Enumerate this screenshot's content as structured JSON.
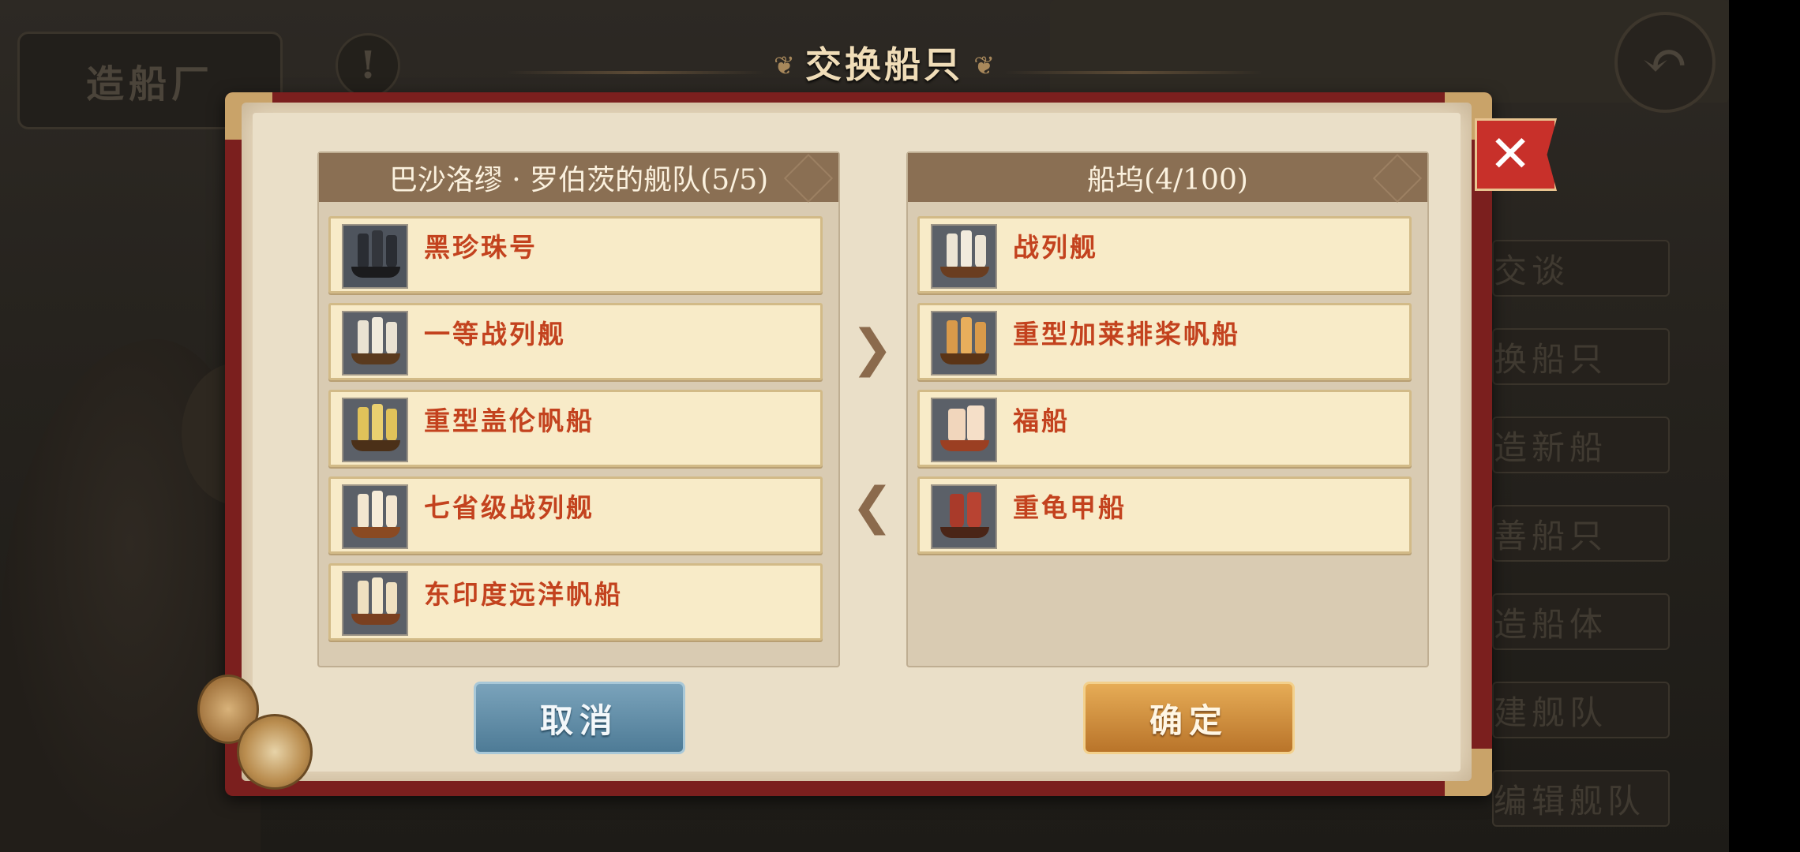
{
  "background": {
    "shipyard_sign": "造船厂",
    "warning_icon_text": "!",
    "back_icon": "back-arrow-icon",
    "side_menu": [
      "交谈",
      "换船只",
      "造新船",
      "善船只",
      "造船体",
      "建舰队",
      "编辑舰队"
    ]
  },
  "title": "交换船只",
  "left_panel": {
    "header": "巴沙洛缪 · 罗伯茨的舰队(5/5)",
    "ships": [
      {
        "name": "黑珍珠号",
        "icon": "black-sail-ship-icon"
      },
      {
        "name": "一等战列舰",
        "icon": "ship-of-the-line-icon"
      },
      {
        "name": "重型盖伦帆船",
        "icon": "yellow-sail-galleon-icon"
      },
      {
        "name": "七省级战列舰",
        "icon": "white-sail-warship-icon"
      },
      {
        "name": "东印度远洋帆船",
        "icon": "east-indiaman-icon"
      }
    ]
  },
  "right_panel": {
    "header": "船坞(4/100)",
    "ships": [
      {
        "name": "战列舰",
        "icon": "warship-icon"
      },
      {
        "name": "重型加莱排桨帆船",
        "icon": "galley-icon"
      },
      {
        "name": "福船",
        "icon": "fuchuan-junk-icon"
      },
      {
        "name": "重龟甲船",
        "icon": "turtle-ship-icon"
      }
    ]
  },
  "transfer": {
    "to_right_glyph": "❯",
    "to_left_glyph": "❮"
  },
  "buttons": {
    "cancel": "取消",
    "confirm": "确定",
    "close_glyph": "✕"
  },
  "colors": {
    "ship_name": "#c3421e",
    "header_bg": "#8a6f53",
    "book_cover": "#7b1f1e",
    "close_red": "#c8302a",
    "cancel_blue": "#5b87a2",
    "confirm_gold": "#d08f3e"
  }
}
